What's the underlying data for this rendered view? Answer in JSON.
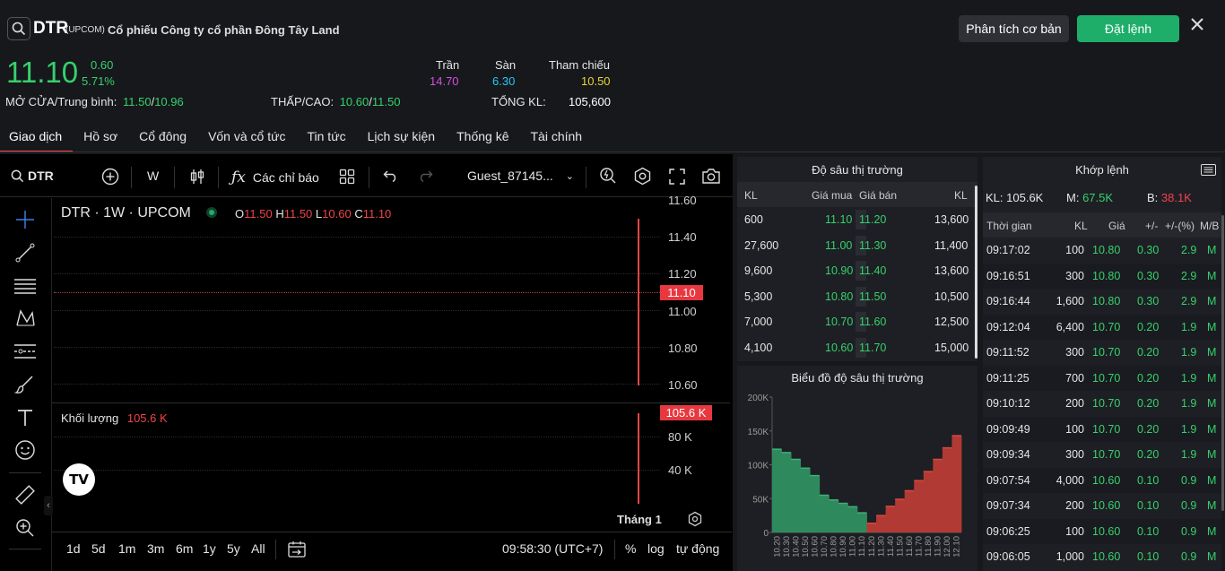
{
  "header": {
    "symbol": "DTR",
    "exchange": "(UPCOM)",
    "company": "Cổ phiếu Công ty cổ phần Đông Tây Land",
    "price": "11.10",
    "change": "0.60",
    "change_pct": "5.71%",
    "ceiling_label": "Trần",
    "ceiling": "14.70",
    "floor_label": "Sàn",
    "floor": "6.30",
    "ref_label": "Tham chiếu",
    "ref": "10.50",
    "open_avg_label": "MỞ CỬA/Trung bình:",
    "open": "11.50",
    "avg": "10.96",
    "lowhigh_label": "THẤP/CAO:",
    "low": "10.60",
    "high": "11.50",
    "volume_label": "TỔNG KL:",
    "volume": "105,600",
    "analysis_button": "Phân tích cơ bản",
    "order_button": "Đặt lệnh",
    "slash": "/"
  },
  "tabs": [
    "Giao dịch",
    "Hồ sơ",
    "Cổ đông",
    "Vốn và cổ tức",
    "Tin tức",
    "Lịch sự kiện",
    "Thống kê",
    "Tài chính"
  ],
  "chart": {
    "toolbar": {
      "symbol": "DTR",
      "interval": "W",
      "indicators": "Các chỉ báo",
      "user": "Guest_87145..."
    },
    "legend": {
      "title": "DTR · 1W · UPCOM",
      "o_label": "O",
      "o": "11.50",
      "h_label": "H",
      "h": "11.50",
      "l_label": "L",
      "l": "10.60",
      "c_label": "C",
      "c": "11.10"
    },
    "price_axis": [
      "11.60",
      "11.40",
      "11.20",
      "11.00",
      "10.80",
      "10.60"
    ],
    "last_price_tag": "11.10",
    "volume_label": "Khối lượng",
    "volume_value": "105.6 K",
    "volume_tag": "105.6 K",
    "volume_axis": [
      "80 K",
      "40 K"
    ],
    "month_label": "Tháng 1",
    "ranges": [
      "1d",
      "5d",
      "1m",
      "3m",
      "6m",
      "1y",
      "5y",
      "All"
    ],
    "clock": "09:58:30 (UTC+7)",
    "pct": "%",
    "log": "log",
    "auto": "tự động"
  },
  "depth": {
    "title": "Độ sâu thị trường",
    "headers": {
      "kl1": "KL",
      "bid": "Giá mua",
      "ask": "Giá bán",
      "kl2": "KL"
    },
    "rows": [
      {
        "bid_vol": "600",
        "bid": "11.10",
        "ask": "11.20",
        "ask_vol": "13,600"
      },
      {
        "bid_vol": "27,600",
        "bid": "11.00",
        "ask": "11.30",
        "ask_vol": "11,400"
      },
      {
        "bid_vol": "9,600",
        "bid": "10.90",
        "ask": "11.40",
        "ask_vol": "13,600"
      },
      {
        "bid_vol": "5,300",
        "bid": "10.80",
        "ask": "11.50",
        "ask_vol": "10,500"
      },
      {
        "bid_vol": "7,000",
        "bid": "10.70",
        "ask": "11.60",
        "ask_vol": "12,500"
      },
      {
        "bid_vol": "4,100",
        "bid": "10.60",
        "ask": "11.70",
        "ask_vol": "15,000"
      }
    ]
  },
  "depth_chart": {
    "title": "Biểu đồ độ sâu thị trường",
    "y_ticks": [
      "200K",
      "150K",
      "100K",
      "50K",
      "0"
    ],
    "bid_color": "#2e8a5c",
    "ask_color": "#b23a34"
  },
  "chart_data": {
    "type": "area",
    "title": "Biểu đồ độ sâu thị trường",
    "categories": [
      "10.20",
      "10.30",
      "10.40",
      "10.50",
      "10.60",
      "10.70",
      "10.80",
      "10.90",
      "11.00",
      "11.10",
      "11.20",
      "11.30",
      "11.40",
      "11.50",
      "11.60",
      "11.70",
      "11.80",
      "11.90",
      "12.00",
      "12.10"
    ],
    "ylim": [
      0,
      200000
    ],
    "series": [
      {
        "values": [
          123000,
          118000,
          108000,
          95000,
          84000,
          55000,
          48000,
          43000,
          38000,
          29000,
          0,
          0,
          0,
          0,
          0,
          0,
          0,
          0,
          0,
          0
        ]
      },
      {
        "values": [
          0,
          0,
          0,
          0,
          0,
          0,
          0,
          0,
          0,
          0,
          13600,
          25000,
          38600,
          49100,
          61600,
          76600,
          90000,
          108000,
          125000,
          143000
        ]
      }
    ]
  },
  "trades": {
    "title": "Khớp lệnh",
    "kl_label": "KL:",
    "kl": "105.6K",
    "m_label": "M:",
    "m": "67.5K",
    "b_label": "B:",
    "b": "38.1K",
    "headers": {
      "time": "Thời gian",
      "kl": "KL",
      "price": "Giá",
      "chg": "+/-",
      "pct": "+/-(%)",
      "side": "M/B"
    },
    "rows": [
      {
        "time": "09:17:02",
        "kl": "100",
        "price": "10.80",
        "chg": "0.30",
        "pct": "2.9",
        "side": "M"
      },
      {
        "time": "09:16:51",
        "kl": "300",
        "price": "10.80",
        "chg": "0.30",
        "pct": "2.9",
        "side": "M"
      },
      {
        "time": "09:16:44",
        "kl": "1,600",
        "price": "10.80",
        "chg": "0.30",
        "pct": "2.9",
        "side": "M"
      },
      {
        "time": "09:12:04",
        "kl": "6,400",
        "price": "10.70",
        "chg": "0.20",
        "pct": "1.9",
        "side": "M"
      },
      {
        "time": "09:11:52",
        "kl": "300",
        "price": "10.70",
        "chg": "0.20",
        "pct": "1.9",
        "side": "M"
      },
      {
        "time": "09:11:25",
        "kl": "700",
        "price": "10.70",
        "chg": "0.20",
        "pct": "1.9",
        "side": "M"
      },
      {
        "time": "09:10:12",
        "kl": "200",
        "price": "10.70",
        "chg": "0.20",
        "pct": "1.9",
        "side": "M"
      },
      {
        "time": "09:09:49",
        "kl": "100",
        "price": "10.70",
        "chg": "0.20",
        "pct": "1.9",
        "side": "M"
      },
      {
        "time": "09:09:34",
        "kl": "300",
        "price": "10.70",
        "chg": "0.20",
        "pct": "1.9",
        "side": "M"
      },
      {
        "time": "09:07:54",
        "kl": "4,000",
        "price": "10.60",
        "chg": "0.10",
        "pct": "0.9",
        "side": "M"
      },
      {
        "time": "09:07:34",
        "kl": "200",
        "price": "10.60",
        "chg": "0.10",
        "pct": "0.9",
        "side": "M"
      },
      {
        "time": "09:06:25",
        "kl": "100",
        "price": "10.60",
        "chg": "0.10",
        "pct": "0.9",
        "side": "M"
      },
      {
        "time": "09:06:05",
        "kl": "1,000",
        "price": "10.60",
        "chg": "0.10",
        "pct": "0.9",
        "side": "M"
      }
    ]
  },
  "colors": {
    "up": "#36d16c",
    "down": "#f0434a",
    "accent": "#1fae6a",
    "ceiling": "#d34fe0",
    "floor": "#27c8f0",
    "reference": "#e8d33a"
  }
}
